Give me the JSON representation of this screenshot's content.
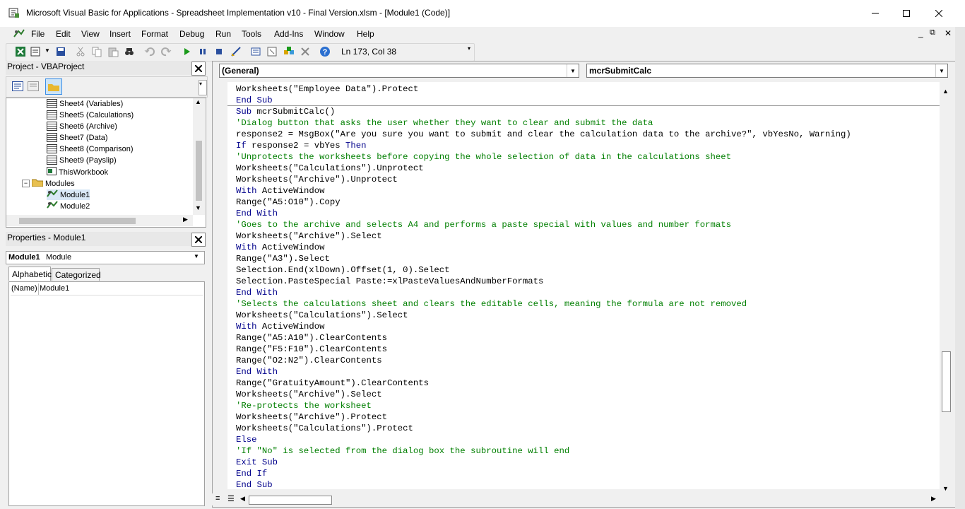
{
  "window": {
    "title": "Microsoft Visual Basic for Applications - Spreadsheet Implementation v10 - Final Version.xlsm - [Module1 (Code)]",
    "minimize_glyph": "—",
    "maximize_glyph": "☐",
    "close_glyph": "✕"
  },
  "menu": {
    "items": [
      {
        "label": "File",
        "icon": "vba-icon"
      },
      {
        "label": "Edit"
      },
      {
        "label": "View"
      },
      {
        "label": "Insert"
      },
      {
        "label": "Format"
      },
      {
        "label": "Debug"
      },
      {
        "label": "Run"
      },
      {
        "label": "Tools"
      },
      {
        "label": "Add-Ins"
      },
      {
        "label": "Window"
      },
      {
        "label": "Help"
      }
    ],
    "mdi_min": "_",
    "mdi_restore": "⧉",
    "mdi_close": "✕"
  },
  "toolbar": {
    "position": "Ln 173, Col 38",
    "icons": [
      "excel-icon",
      "insert-module-icon",
      "save-icon",
      "cut-icon",
      "copy-icon",
      "paste-icon",
      "find-icon",
      "undo-icon",
      "redo-icon",
      "run-icon",
      "break-icon",
      "reset-icon",
      "design-mode-icon",
      "project-explorer-icon",
      "properties-icon",
      "object-browser-icon",
      "toolbox-icon",
      "help-icon"
    ]
  },
  "project": {
    "title": "Project - VBAProject",
    "close": "✕",
    "tree": [
      {
        "label": "Sheet4 (Variables)",
        "type": "sheet"
      },
      {
        "label": "Sheet5 (Calculations)",
        "type": "sheet"
      },
      {
        "label": "Sheet6 (Archive)",
        "type": "sheet"
      },
      {
        "label": "Sheet7 (Data)",
        "type": "sheet"
      },
      {
        "label": "Sheet8 (Comparison)",
        "type": "sheet"
      },
      {
        "label": "Sheet9 (Payslip)",
        "type": "sheet"
      },
      {
        "label": "ThisWorkbook",
        "type": "workbook"
      },
      {
        "label": "Modules",
        "type": "folder"
      },
      {
        "label": "Module1",
        "type": "module"
      },
      {
        "label": "Module2",
        "type": "module"
      }
    ]
  },
  "properties": {
    "title": "Properties - Module1",
    "close": "✕",
    "object_name": "Module1",
    "object_type": "Module",
    "tabs": [
      "Alphabetic",
      "Categorized"
    ],
    "rows": [
      {
        "name": "(Name)",
        "value": "Module1"
      }
    ]
  },
  "code": {
    "object_combo": "(General)",
    "proc_combo": "mcrSubmitCalc",
    "lines": [
      {
        "parts": [
          {
            "t": "tx",
            "v": "Worksheets(\"Employee Data\").Protect"
          }
        ]
      },
      {
        "parts": [
          {
            "t": "kw",
            "v": "End Sub"
          }
        ]
      },
      {
        "parts": [
          {
            "t": "kw",
            "v": "Sub"
          },
          {
            "t": "tx",
            "v": " mcrSubmitCalc()"
          }
        ]
      },
      {
        "parts": [
          {
            "t": "cm",
            "v": "'Dialog button that asks the user whether they want to clear and submit the data"
          }
        ]
      },
      {
        "parts": [
          {
            "t": "tx",
            "v": "response2 = MsgBox(\"Are you sure you want to submit and clear the calculation data to the archive?\", vbYesNo, Warning)"
          }
        ]
      },
      {
        "parts": [
          {
            "t": "kw",
            "v": "If"
          },
          {
            "t": "tx",
            "v": " response2 = vbYes "
          },
          {
            "t": "kw",
            "v": "Then"
          }
        ]
      },
      {
        "parts": [
          {
            "t": "cm",
            "v": "'Unprotects the worksheets before copying the whole selection of data in the calculations sheet"
          }
        ]
      },
      {
        "parts": [
          {
            "t": "tx",
            "v": "Worksheets(\"Calculations\").Unprotect"
          }
        ]
      },
      {
        "parts": [
          {
            "t": "tx",
            "v": "Worksheets(\"Archive\").Unprotect"
          }
        ]
      },
      {
        "parts": [
          {
            "t": "kw",
            "v": "With"
          },
          {
            "t": "tx",
            "v": " ActiveWindow"
          }
        ]
      },
      {
        "parts": [
          {
            "t": "tx",
            "v": "Range(\"A5:O10\").Copy"
          }
        ]
      },
      {
        "parts": [
          {
            "t": "kw",
            "v": "End With"
          }
        ]
      },
      {
        "parts": [
          {
            "t": "cm",
            "v": "'Goes to the archive and selects A4 and performs a paste special with values and number formats"
          }
        ]
      },
      {
        "parts": [
          {
            "t": "tx",
            "v": "Worksheets(\"Archive\").Select"
          }
        ]
      },
      {
        "parts": [
          {
            "t": "kw",
            "v": "With"
          },
          {
            "t": "tx",
            "v": " ActiveWindow"
          }
        ]
      },
      {
        "parts": [
          {
            "t": "tx",
            "v": "Range(\"A3\").Select"
          }
        ]
      },
      {
        "parts": [
          {
            "t": "tx",
            "v": "Selection.End(xlDown).Offset(1, 0).Select"
          }
        ]
      },
      {
        "parts": [
          {
            "t": "tx",
            "v": "Selection.PasteSpecial Paste:=xlPasteValuesAndNumberFormats"
          }
        ]
      },
      {
        "parts": [
          {
            "t": "kw",
            "v": "End With"
          }
        ]
      },
      {
        "parts": [
          {
            "t": "cm",
            "v": "'Selects the calculations sheet and clears the editable cells, meaning the formula are not removed"
          }
        ]
      },
      {
        "parts": [
          {
            "t": "tx",
            "v": "Worksheets(\"Calculations\").Select"
          }
        ]
      },
      {
        "parts": [
          {
            "t": "kw",
            "v": "With"
          },
          {
            "t": "tx",
            "v": " ActiveWindow"
          }
        ]
      },
      {
        "parts": [
          {
            "t": "tx",
            "v": "Range(\"A5:A10\").ClearContents"
          }
        ]
      },
      {
        "parts": [
          {
            "t": "tx",
            "v": "Range(\"F5:F10\").ClearContents"
          }
        ]
      },
      {
        "parts": [
          {
            "t": "tx",
            "v": "Range(\"O2:N2\").ClearContents"
          }
        ]
      },
      {
        "parts": [
          {
            "t": "kw",
            "v": "End With"
          }
        ]
      },
      {
        "parts": [
          {
            "t": "tx",
            "v": "Range(\"GratuityAmount\").ClearContents"
          }
        ]
      },
      {
        "parts": [
          {
            "t": "tx",
            "v": "Worksheets(\"Archive\").Select"
          }
        ]
      },
      {
        "parts": [
          {
            "t": "cm",
            "v": "'Re-protects the worksheet"
          }
        ]
      },
      {
        "parts": [
          {
            "t": "tx",
            "v": "Worksheets(\"Archive\").Protect"
          }
        ]
      },
      {
        "parts": [
          {
            "t": "tx",
            "v": "Worksheets(\"Calculations\").Protect"
          }
        ]
      },
      {
        "parts": [
          {
            "t": "kw",
            "v": "Else"
          }
        ]
      },
      {
        "parts": [
          {
            "t": "cm",
            "v": "'If \"No\" is selected from the dialog box the subroutine will end"
          }
        ]
      },
      {
        "parts": [
          {
            "t": "kw",
            "v": "Exit Sub"
          }
        ]
      },
      {
        "parts": [
          {
            "t": "kw",
            "v": "End If"
          }
        ]
      },
      {
        "parts": [
          {
            "t": "kw",
            "v": "End Sub"
          }
        ]
      }
    ]
  },
  "colors": {
    "keyword": "#00008b",
    "comment": "#007f00",
    "text": "#000000"
  }
}
